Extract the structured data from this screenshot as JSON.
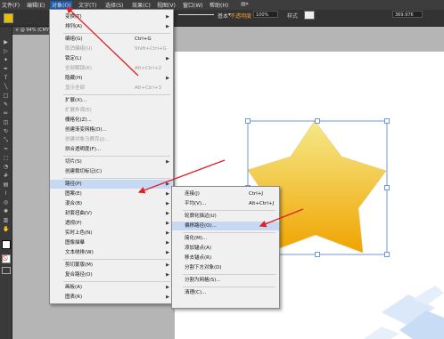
{
  "menubar": {
    "items": [
      {
        "label": "文件(F)"
      },
      {
        "label": "编辑(E)"
      },
      {
        "label": "对象(O)"
      },
      {
        "label": "文字(T)"
      },
      {
        "label": "选择(S)"
      },
      {
        "label": "效果(C)"
      },
      {
        "label": "视图(V)"
      },
      {
        "label": "窗口(W)"
      },
      {
        "label": "帮助(H)"
      }
    ]
  },
  "controlbar": {
    "stroke_style": "基本",
    "opacity_label": "不透明度",
    "opacity_value": "100%",
    "style_label": "样式",
    "coordinate_value": "369.976"
  },
  "document": {
    "tab_label": "@ 94% (CMYK"
  },
  "object_menu": {
    "items": [
      {
        "label": "变换(T)",
        "submenu": true
      },
      {
        "label": "排列(A)",
        "submenu": true
      },
      {
        "label": "编组(G)",
        "shortcut": "Ctrl+G"
      },
      {
        "label": "取消编组(U)",
        "shortcut": "Shift+Ctrl+G",
        "disabled": true
      },
      {
        "label": "锁定(L)",
        "submenu": true
      },
      {
        "label": "全部解锁(K)",
        "shortcut": "Alt+Ctrl+2",
        "disabled": true
      },
      {
        "label": "隐藏(H)",
        "submenu": true
      },
      {
        "label": "显示全部",
        "shortcut": "Alt+Ctrl+3",
        "disabled": true
      },
      {
        "label": "扩展(X)..."
      },
      {
        "label": "扩展外观(E)",
        "disabled": true
      },
      {
        "label": "栅格化(Z)..."
      },
      {
        "label": "创建渐变网格(D)..."
      },
      {
        "label": "创建对象马赛克(J)...",
        "disabled": true
      },
      {
        "label": "拼合透明度(F)..."
      },
      {
        "label": "切片(S)",
        "submenu": true
      },
      {
        "label": "创建裁切标记(C)"
      },
      {
        "label": "路径(P)",
        "submenu": true,
        "highlighted": true
      },
      {
        "label": "图案(E)",
        "submenu": true
      },
      {
        "label": "混合(B)",
        "submenu": true
      },
      {
        "label": "封套扭曲(V)",
        "submenu": true
      },
      {
        "label": "透视(P)",
        "submenu": true
      },
      {
        "label": "实时上色(N)",
        "submenu": true
      },
      {
        "label": "图像描摹",
        "submenu": true
      },
      {
        "label": "文本绕排(W)",
        "submenu": true
      },
      {
        "label": "剪切蒙版(M)",
        "submenu": true
      },
      {
        "label": "复合路径(O)",
        "submenu": true
      },
      {
        "label": "画板(A)",
        "submenu": true
      },
      {
        "label": "图表(R)",
        "submenu": true
      }
    ]
  },
  "path_submenu": {
    "items": [
      {
        "label": "连接(J)",
        "shortcut": "Ctrl+J"
      },
      {
        "label": "平均(V)...",
        "shortcut": "Alt+Ctrl+J"
      },
      {
        "label": "轮廓化描边(U)"
      },
      {
        "label": "偏移路径(O)...",
        "highlighted": true
      },
      {
        "label": "简化(M)..."
      },
      {
        "label": "添加锚点(A)"
      },
      {
        "label": "移去锚点(R)"
      },
      {
        "label": "分割下方对象(D)"
      },
      {
        "label": "分割为网格(S)..."
      },
      {
        "label": "清理(C)..."
      }
    ]
  },
  "colors": {
    "accent": "#e02020",
    "star_top": "#f5e98a",
    "star_bottom": "#f0a400",
    "selection": "#4a7fd6"
  }
}
